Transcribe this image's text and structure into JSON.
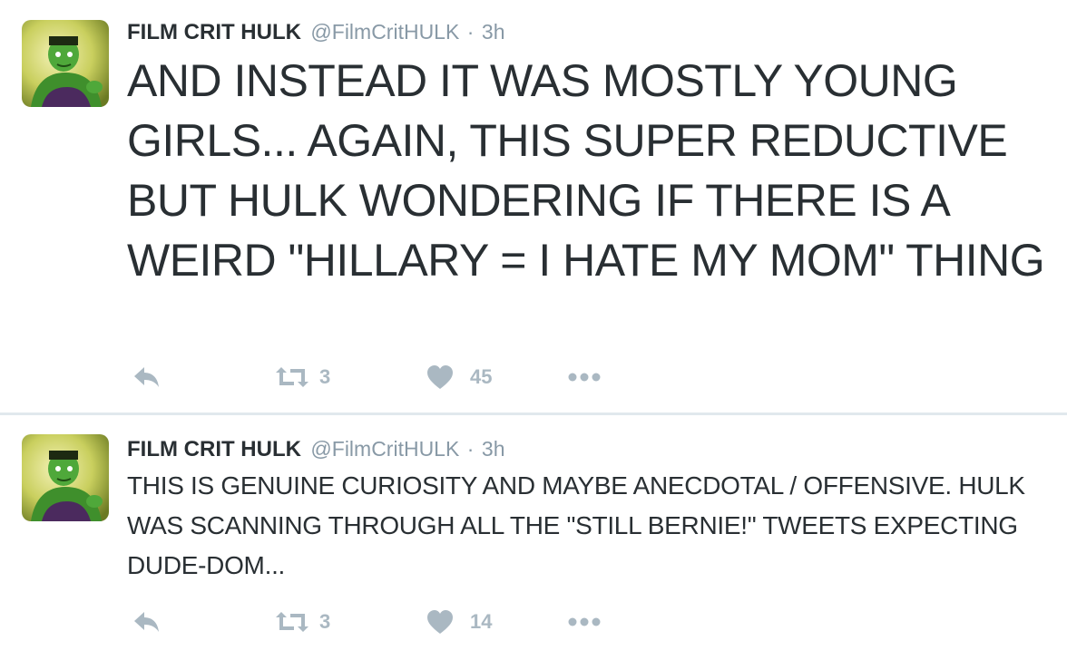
{
  "colors": {
    "text": "#292f33",
    "meta": "#8899a6",
    "action_icons": "#aab8c2",
    "divider": "#e1e8ed"
  },
  "tweets": [
    {
      "display_name": "FILM CRIT HULK",
      "handle": "@FilmCritHULK",
      "separator": "·",
      "time": "3h",
      "text": "AND INSTEAD IT WAS MOSTLY YOUNG GIRLS... AGAIN, THIS SUPER REDUCTIVE BUT HULK WONDERING IF THERE IS A WEIRD \"HILLARY = I HATE MY MOM\" THING",
      "avatar_icon": "hulk-avatar",
      "actions": {
        "reply_icon": "reply-icon",
        "retweet_icon": "retweet-icon",
        "retweet_count": "3",
        "like_icon": "heart-icon",
        "like_count": "45",
        "more_icon": "more-dots-icon"
      }
    },
    {
      "display_name": "FILM CRIT HULK",
      "handle": "@FilmCritHULK",
      "separator": "·",
      "time": "3h",
      "text": "THIS IS GENUINE CURIOSITY AND MAYBE ANECDOTAL / OFFENSIVE. HULK WAS SCANNING THROUGH ALL THE \"STILL BERNIE!\" TWEETS EXPECTING DUDE-DOM...",
      "avatar_icon": "hulk-avatar",
      "actions": {
        "reply_icon": "reply-icon",
        "retweet_icon": "retweet-icon",
        "retweet_count": "3",
        "like_icon": "heart-icon",
        "like_count": "14",
        "more_icon": "more-dots-icon"
      }
    }
  ]
}
